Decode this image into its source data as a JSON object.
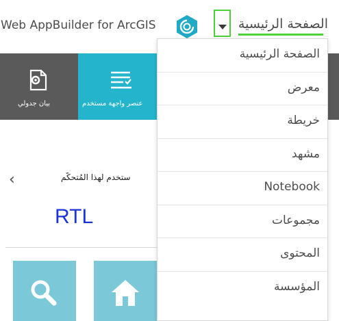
{
  "header": {
    "app_title": "Web AppBuilder for ArcGIS",
    "home_link": "الصفحة الرئيسية",
    "logo_icon": "arcgis-logo-icon",
    "caret_icon": "caret-down-icon",
    "accent_color": "#4cd137"
  },
  "tiles": [
    {
      "label": "بيان جدولي",
      "icon": "table-document-gear-icon",
      "color": "#5a5a5a"
    },
    {
      "label": "عنصر واجهة مستخدم",
      "icon": "list-widget-icon",
      "color": "#24b5cc"
    }
  ],
  "main": {
    "widget_hint": "ستخدم لهذا المُتحكّم",
    "chevron_icon": "chevron-left-icon",
    "rtl_label": "RTL",
    "rtl_color": "#1b34d8"
  },
  "bottom_tiles": [
    {
      "icon": "search-icon"
    },
    {
      "icon": "home-icon"
    },
    {
      "icon": "placeholder-icon"
    },
    {
      "icon": "placeholder-icon"
    }
  ],
  "dropdown": {
    "items": [
      {
        "label": "الصفحة الرئيسية"
      },
      {
        "label": "معرض"
      },
      {
        "label": "خريطة"
      },
      {
        "label": "مشهد"
      },
      {
        "label": "Notebook"
      },
      {
        "label": "مجموعات"
      },
      {
        "label": "المحتوى"
      },
      {
        "label": "المؤسسة"
      }
    ]
  }
}
